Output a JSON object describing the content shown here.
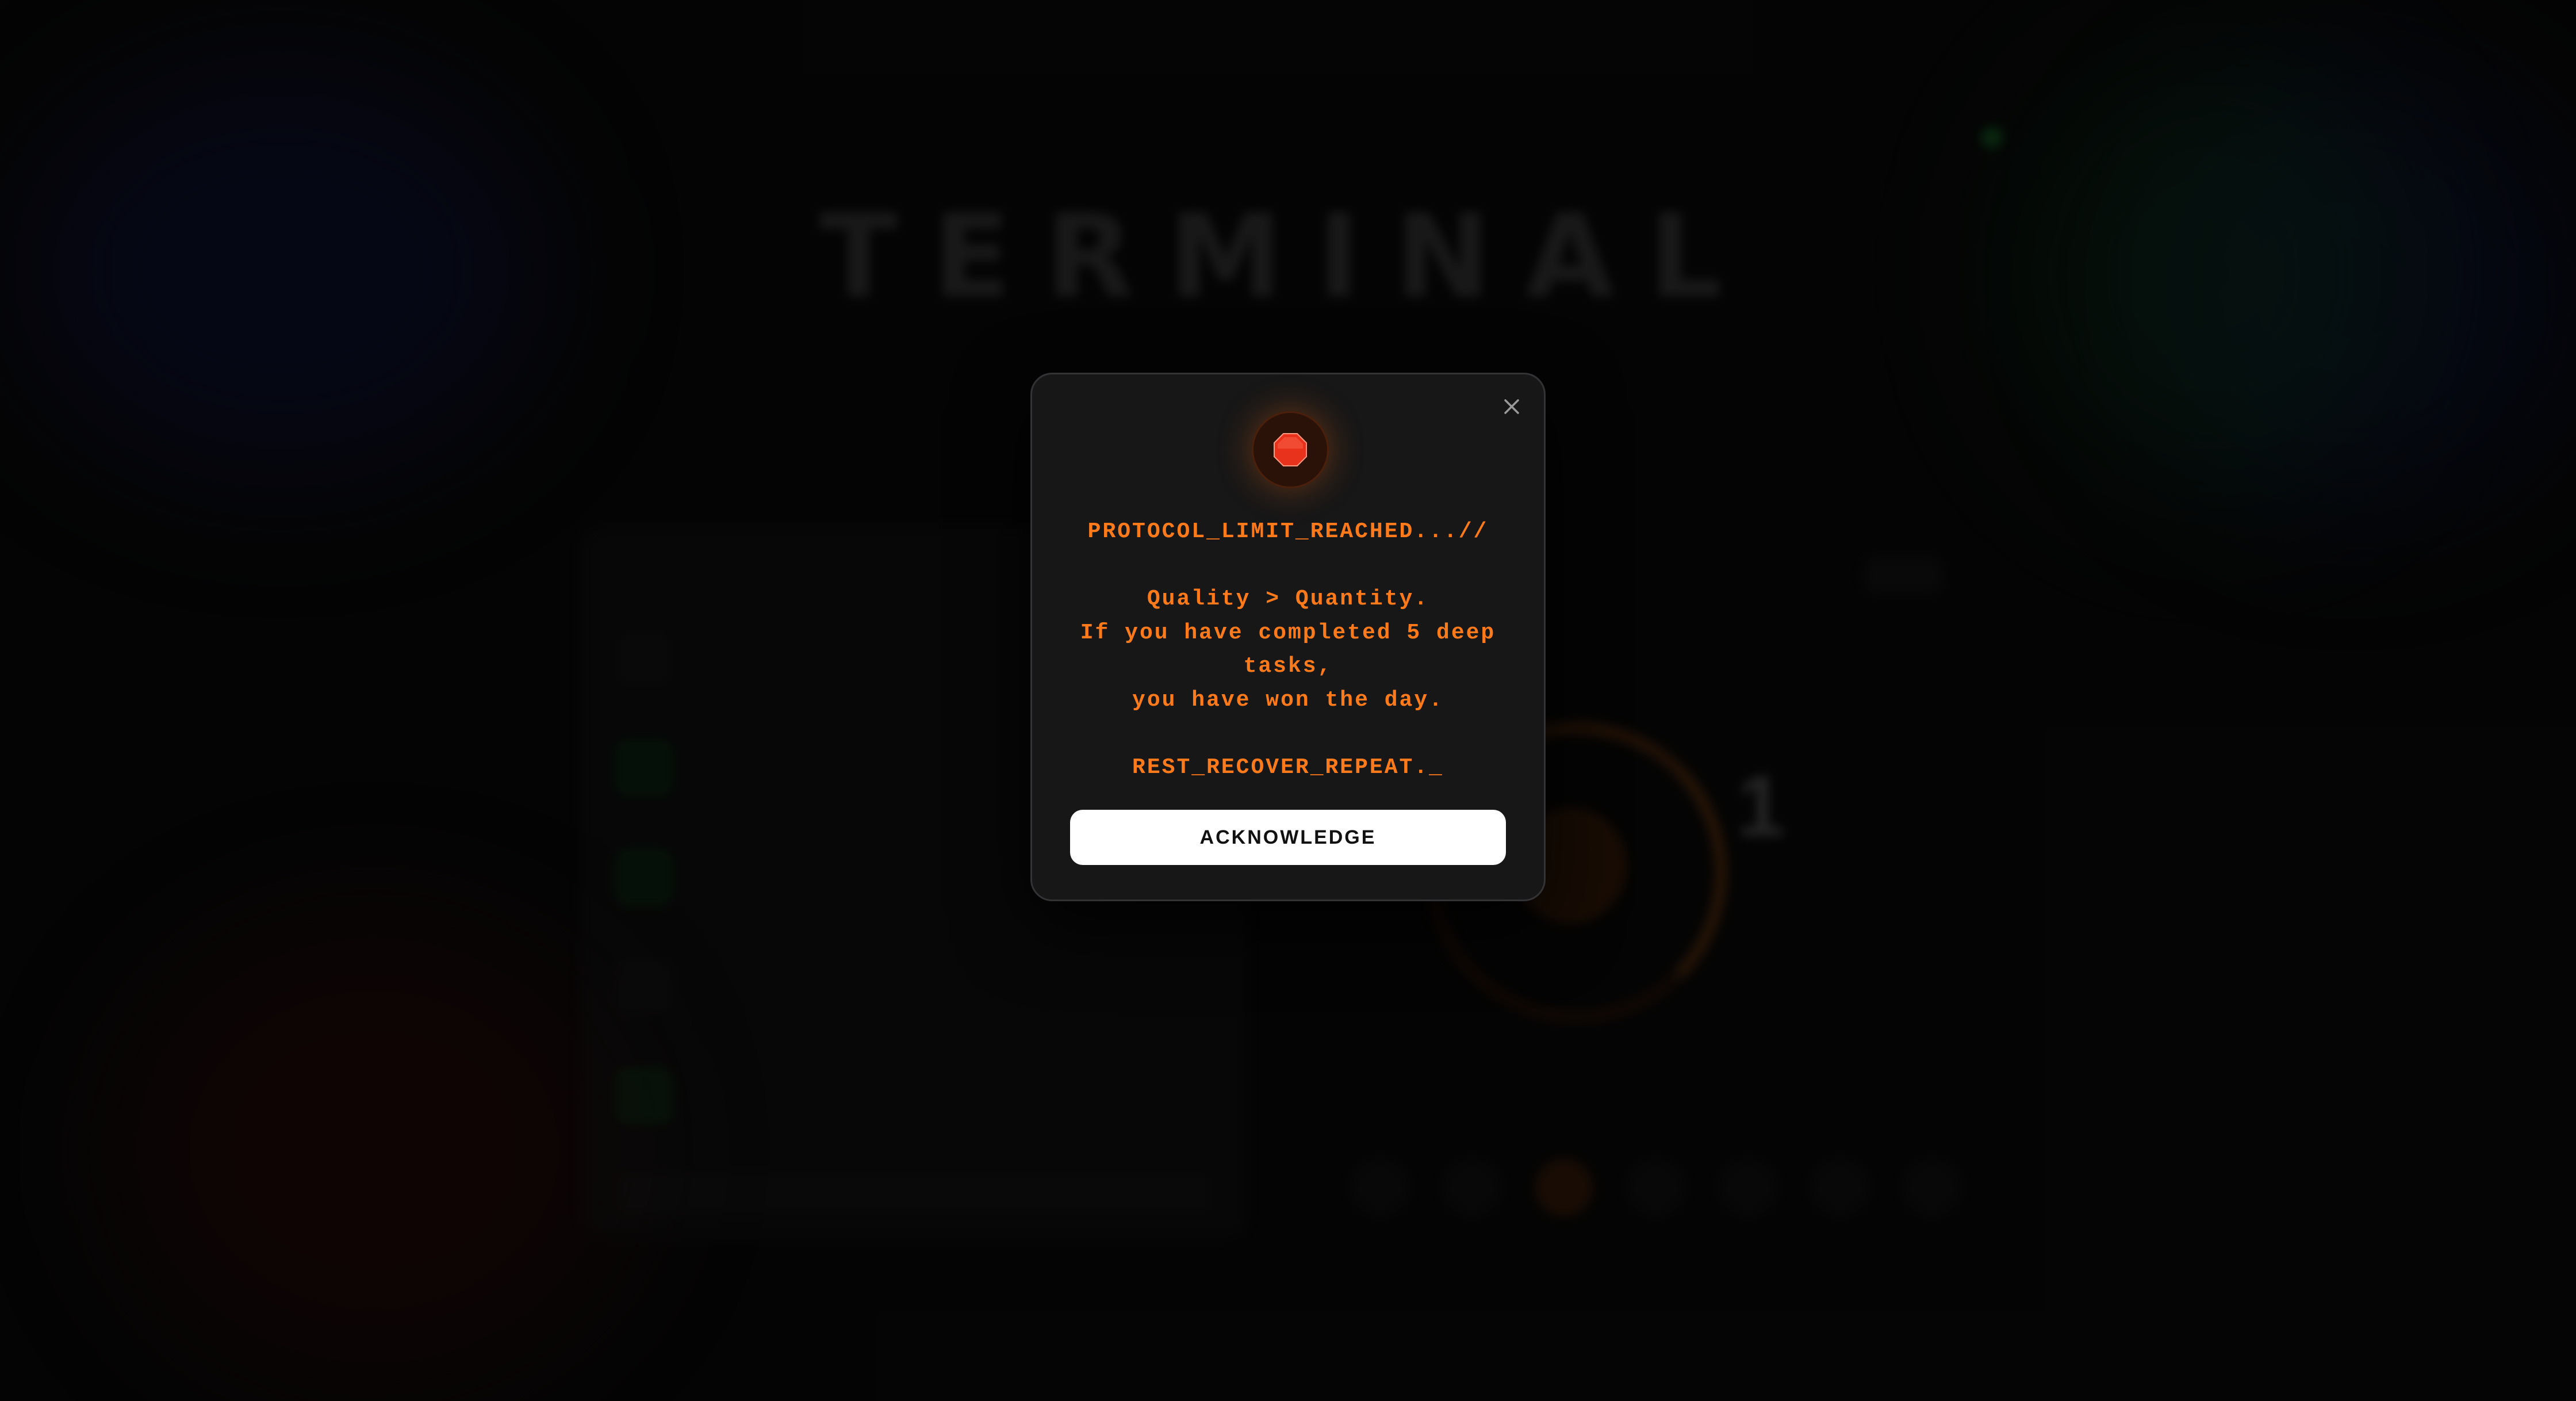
{
  "background_app": {
    "title": "TERMINAL",
    "stat_number": "1"
  },
  "modal": {
    "icon": "stop-sign-icon",
    "heading": "PROTOCOL_LIMIT_REACHED...//",
    "lines": [
      "Quality > Quantity.",
      "If you have completed 5 deep tasks,",
      "you have won the day."
    ],
    "footer_line": "REST_RECOVER_REPEAT._",
    "button_label": "ACKNOWLEDGE",
    "close_icon": "close-icon"
  },
  "colors": {
    "accent": "#ff7a1a",
    "modal_bg": "#171717",
    "button_bg": "#ffffff",
    "stop_red": "#e8321c"
  }
}
